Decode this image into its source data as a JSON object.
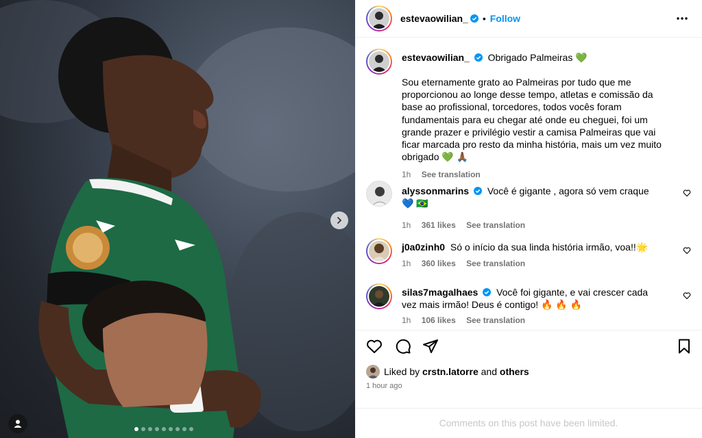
{
  "post": {
    "author": "estevaowilian_",
    "follow_label": "Follow",
    "bullet": "•",
    "more_label": "···"
  },
  "caption": {
    "username": "estevaowilian_",
    "title": "Obrigado Palmeiras 💚",
    "text": "Sou eternamente grato ao Palmeiras por tudo que me proporcionou ao longe desse tempo, atletas e comissão da base ao profissional, torcedores, todos vocês foram fundamentais para eu chegar até onde eu cheguei, foi um grande prazer e privilégio vestir a camisa Palmeiras que vai ficar marcada pro resto da minha história, mais um vez muito obrigado 💚 🙏🏾",
    "time": "1h",
    "see_translation": "See translation"
  },
  "comments": [
    {
      "username": "alyssonmarins",
      "verified": true,
      "text": "Você é gigante , agora só vem craque 💙 🇧🇷",
      "time": "1h",
      "likes": "361 likes",
      "see_translation": "See translation"
    },
    {
      "username": "j0a0zinh0",
      "verified": false,
      "text": "Só o início da sua linda história irmão, voa!!🌟",
      "time": "1h",
      "likes": "360 likes",
      "see_translation": "See translation"
    },
    {
      "username": "silas7magalhaes",
      "verified": true,
      "text": "Você foi gigante, e vai crescer cada vez mais irmão! Deus é contigo! 🔥 🔥 🔥",
      "time": "1h",
      "likes": "106 likes",
      "see_translation": "See translation"
    }
  ],
  "likes": {
    "prefix": "Liked by",
    "user": "crstn.latorre",
    "and": "and",
    "others": "others"
  },
  "timestamp": "1 hour ago",
  "limited_notice": "Comments on this post have been limited.",
  "carousel": {
    "total": 9,
    "active": 1
  },
  "colors": {
    "accent": "#0095f6",
    "verified": "#0095f6",
    "jersey": "#1d6a45"
  },
  "icons": [
    "heart-icon",
    "comment-icon",
    "share-icon",
    "bookmark-icon",
    "more-icon",
    "chevron-right-icon",
    "user-tag-icon",
    "verified-icon"
  ]
}
